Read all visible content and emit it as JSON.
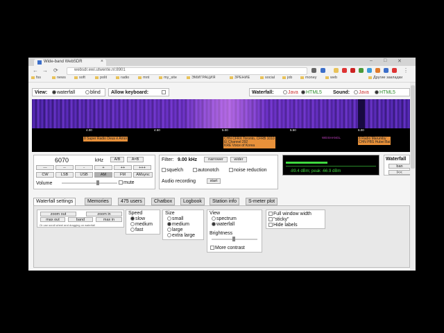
{
  "browser": {
    "tab_title": "Wide-band WebSDR",
    "tab_close": "×",
    "url": "websdr.ewi.utwente.nl:8901",
    "bookmarks": [
      "fss",
      "news",
      "soft",
      "polit",
      "radio",
      "mnt",
      "my_site",
      "ЭМИГРАЦИЯ",
      "ЗРЕНИЕ",
      "social",
      "job",
      "money",
      "web",
      "Другие закладки"
    ]
  },
  "view": {
    "label": "View:",
    "waterfall": "waterfall",
    "blind": "blind",
    "keyboard_label": "Allow keyboard:",
    "waterfall_sel_label": "Waterfall:",
    "java1": "Java",
    "html5_1": "HTML5",
    "sound_label": "Sound:",
    "java2": "Java",
    "html5_2": "HTML5"
  },
  "scale": {
    "ticks": [
      "4.00",
      "4.50",
      "5.00",
      "5.50",
      "6.00"
    ]
  },
  "stations": [
    {
      "text": "8 Super Radio Deus é Amor"
    },
    {
      "text": "CHN CFRX Toronto, CFRB 1010\nEl Channel 292\nKRE Voice of Korea"
    },
    {
      "text": "8 Radio Marumby\nCHN PBS Hubei Bai"
    }
  ],
  "stations_misc": "WEISHANGL",
  "tuning": {
    "frequency": "6070",
    "unit": "kHz",
    "ab": "A/B",
    "a_eq_b": "A=B",
    "steps": [
      "---",
      "--",
      "-",
      "+",
      "++",
      "+++"
    ],
    "modes": [
      "CW",
      "LSB",
      "USB",
      "AM",
      "FM",
      "AMsync"
    ],
    "active_mode": "AM",
    "volume_label": "Volume",
    "mute_label": "mute"
  },
  "filter": {
    "label": "Filter:",
    "value": "9.00 kHz",
    "narrower": "narrower",
    "wider": "wider",
    "squelch": "squelch",
    "autonotch": "autonotch",
    "noise_reduction": "noise reduction",
    "audio_recording": "Audio recording",
    "start": "start"
  },
  "smeter": {
    "readout": "-89.4 dBm; peak  -66.9 dBm"
  },
  "waterfall_side": {
    "label": "Waterfall",
    "band_btn": "ban",
    "arrow": "l<<"
  },
  "tabs": [
    "Waterfall settings",
    "Memories",
    "475 users",
    "Chatbox",
    "Logbook",
    "Station info",
    "S-meter plot"
  ],
  "wf_settings": {
    "zoom_out": "zoom out",
    "zoom_in": "zoom in",
    "max_out": "max out",
    "band": "band",
    "max_in": "max in",
    "hint": "Or use scroll wheel and dragging on waterfall",
    "speed_label": "Speed",
    "speeds": [
      "slow",
      "medium",
      "fast"
    ],
    "size_label": "Size",
    "sizes": [
      "small",
      "medium",
      "large",
      "extra large"
    ],
    "view_label": "View",
    "views": [
      "spectrum",
      "waterfall"
    ],
    "brightness_label": "Brightness",
    "more_contrast": "More contrast",
    "full_window": "Full window width",
    "sticky": "\"sticky\"",
    "hide_labels": "Hide labels"
  },
  "colors": {
    "accent_orange": "#e8913a",
    "waterfall_purple": "#5b2cc0",
    "smeter_green": "#3fd93f"
  }
}
